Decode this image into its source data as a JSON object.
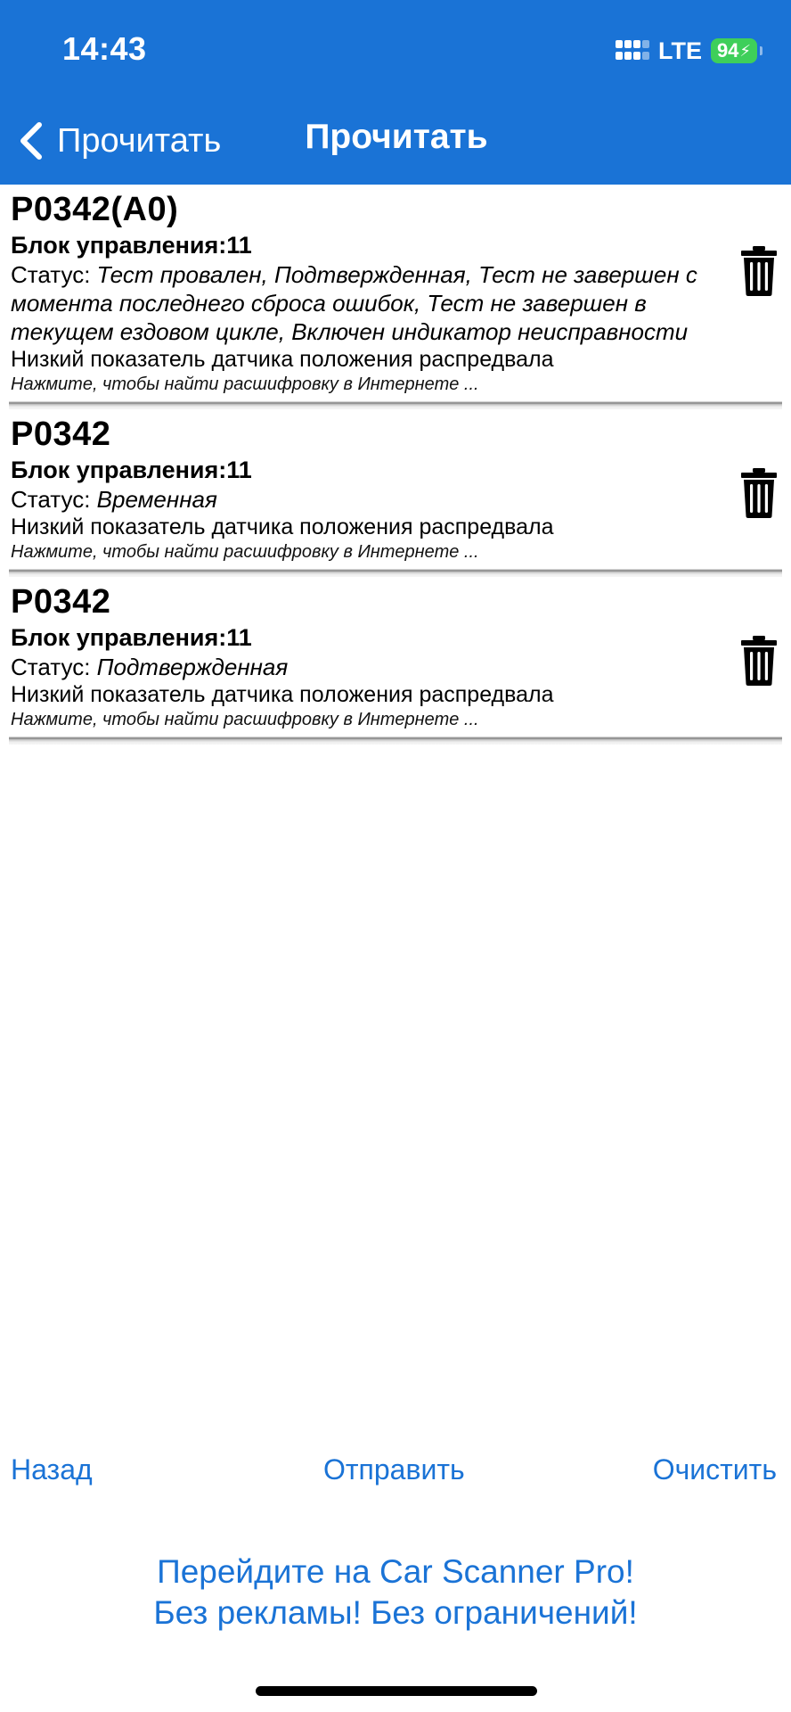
{
  "status_bar": {
    "time": "14:43",
    "network": "LTE",
    "battery": "94"
  },
  "nav": {
    "back_label": "Прочитать",
    "title": "Прочитать"
  },
  "errors": [
    {
      "code": "P0342(A0)",
      "ecu": "Блок управления:11",
      "status_label": "Статус: ",
      "status_value": "Тест провален, Подтвержденная, Тест не завершен с момента последнего сброса ошибок, Тест не завершен в текущем ездовом цикле, Включен индикатор неисправности",
      "description": "Низкий показатель датчика положения распредвала",
      "hint": "Нажмите, чтобы найти расшифровку в Интернете ..."
    },
    {
      "code": "P0342",
      "ecu": "Блок управления:11",
      "status_label": "Статус: ",
      "status_value": "Временная",
      "description": "Низкий показатель датчика положения распредвала",
      "hint": "Нажмите, чтобы найти расшифровку в Интернете ..."
    },
    {
      "code": "P0342",
      "ecu": "Блок управления:11",
      "status_label": "Статус: ",
      "status_value": "Подтвержденная",
      "description": "Низкий показатель датчика положения распредвала",
      "hint": "Нажмите, чтобы найти расшифровку в Интернете ..."
    }
  ],
  "toolbar": {
    "back": "Назад",
    "send": "Отправить",
    "clear": "Очистить"
  },
  "promo": {
    "line1": "Перейдите на Car Scanner Pro!",
    "line2": "Без рекламы! Без ограничений!"
  },
  "colors": {
    "accent": "#1a73d6",
    "battery": "#3ecf5a"
  }
}
